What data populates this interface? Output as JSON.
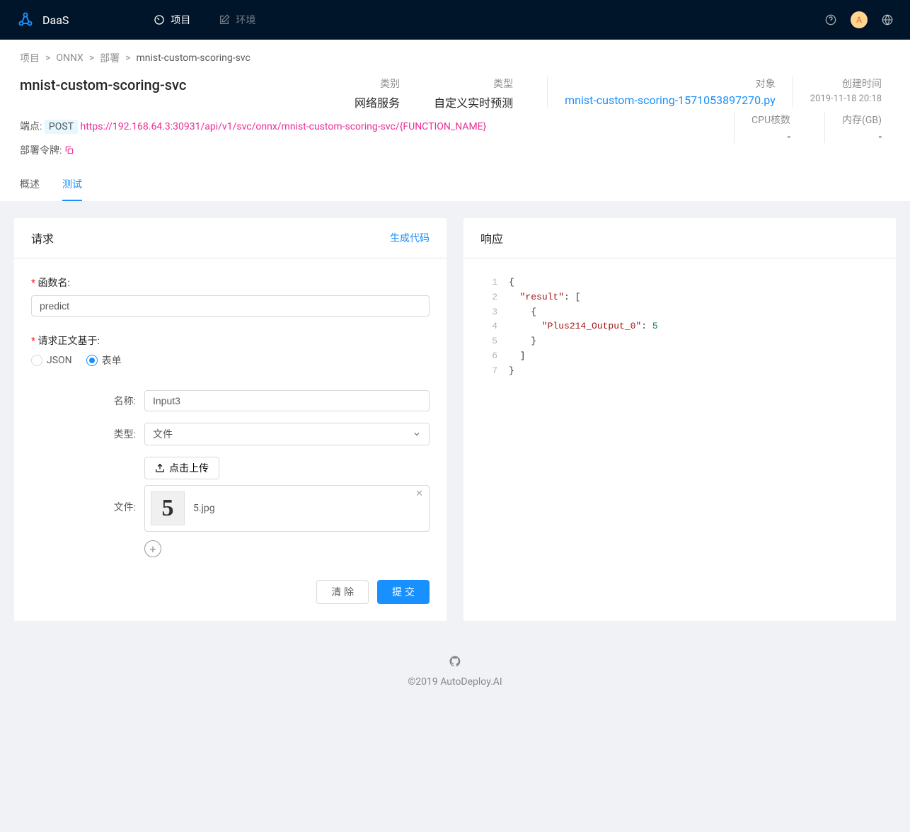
{
  "header": {
    "brand": "DaaS",
    "nav": {
      "projects": "项目",
      "environments": "环境"
    },
    "avatar_letter": "A"
  },
  "breadcrumb": {
    "items": [
      "项目",
      "ONNX",
      "部署",
      "mnist-custom-scoring-svc"
    ]
  },
  "page": {
    "title": "mnist-custom-scoring-svc",
    "info": {
      "category_label": "类别",
      "category_value": "网络服务",
      "type_label": "类型",
      "type_value": "自定义实时预测",
      "object_label": "对象",
      "object_value": "mnist-custom-scoring-1571053897270.py",
      "created_label": "创建时间",
      "created_value": "2019-11-18 20:18",
      "cpu_label": "CPU核数",
      "cpu_value": "-",
      "memory_label": "内存(GB)",
      "memory_value": "-"
    },
    "endpoint": {
      "label": "端点:",
      "method": "POST",
      "url": "https://192.168.64.3:30931/api/v1/svc/onnx/mnist-custom-scoring-svc/{FUNCTION_NAME}"
    },
    "token_label": "部署令牌:"
  },
  "tabs": {
    "overview": "概述",
    "test": "测试"
  },
  "request": {
    "title": "请求",
    "generate_code": "生成代码",
    "function_name_label": "函数名:",
    "function_name_value": "predict",
    "body_based_label": "请求正文基于:",
    "radio_json": "JSON",
    "radio_form": "表单",
    "name_label": "名称:",
    "name_value": "Input3",
    "type_label": "类型:",
    "type_value": "文件",
    "file_label": "文件:",
    "upload_text": "点击上传",
    "uploaded_file": "5.jpg",
    "uploaded_thumb_glyph": "5",
    "clear_btn": "清 除",
    "submit_btn": "提 交"
  },
  "response": {
    "title": "响应",
    "lines": [
      "{",
      "  \"result\": [",
      "    {",
      "      \"Plus214_Output_0\": 5",
      "    }",
      "  ]",
      "}"
    ]
  },
  "footer": {
    "copyright": "©2019 AutoDeploy.AI"
  }
}
